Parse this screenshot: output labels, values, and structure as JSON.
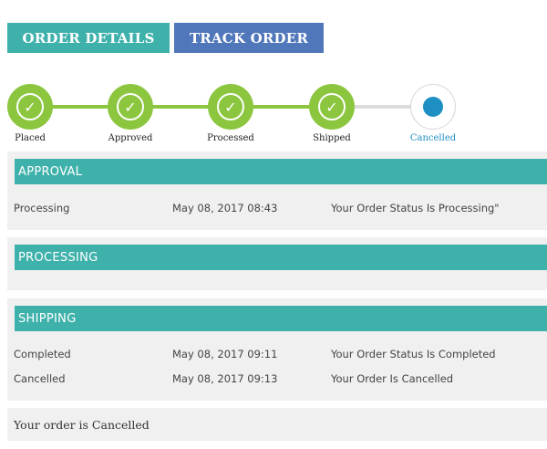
{
  "tabs": {
    "order_details": "ORDER DETAILS",
    "track_order": "TRACK ORDER"
  },
  "tracker": {
    "steps": [
      {
        "label": "Placed",
        "state": "done"
      },
      {
        "label": "Approved",
        "state": "done"
      },
      {
        "label": "Processed",
        "state": "done"
      },
      {
        "label": "Shipped",
        "state": "done"
      },
      {
        "label": "Cancelled",
        "state": "current"
      }
    ],
    "check_glyph": "✓"
  },
  "sections": {
    "approval": {
      "title": "APPROVAL",
      "rows": [
        {
          "status": "Processing",
          "date": "May 08, 2017 08:43",
          "message": "Your Order Status Is Processing\""
        }
      ]
    },
    "processing": {
      "title": "PROCESSING",
      "rows": []
    },
    "shipping": {
      "title": "SHIPPING",
      "rows": [
        {
          "status": "Completed",
          "date": "May 08, 2017 09:11",
          "message": "Your Order Status Is Completed"
        },
        {
          "status": "Cancelled",
          "date": "May 08, 2017 09:13",
          "message": "Your Order Is Cancelled"
        }
      ]
    }
  },
  "final_message": "Your order is Cancelled",
  "colors": {
    "teal": "#3fb1ab",
    "blue": "#5177bb",
    "green": "#8cc63f",
    "current_blue": "#1e8fc2",
    "panel_bg": "#f0f0f0"
  }
}
